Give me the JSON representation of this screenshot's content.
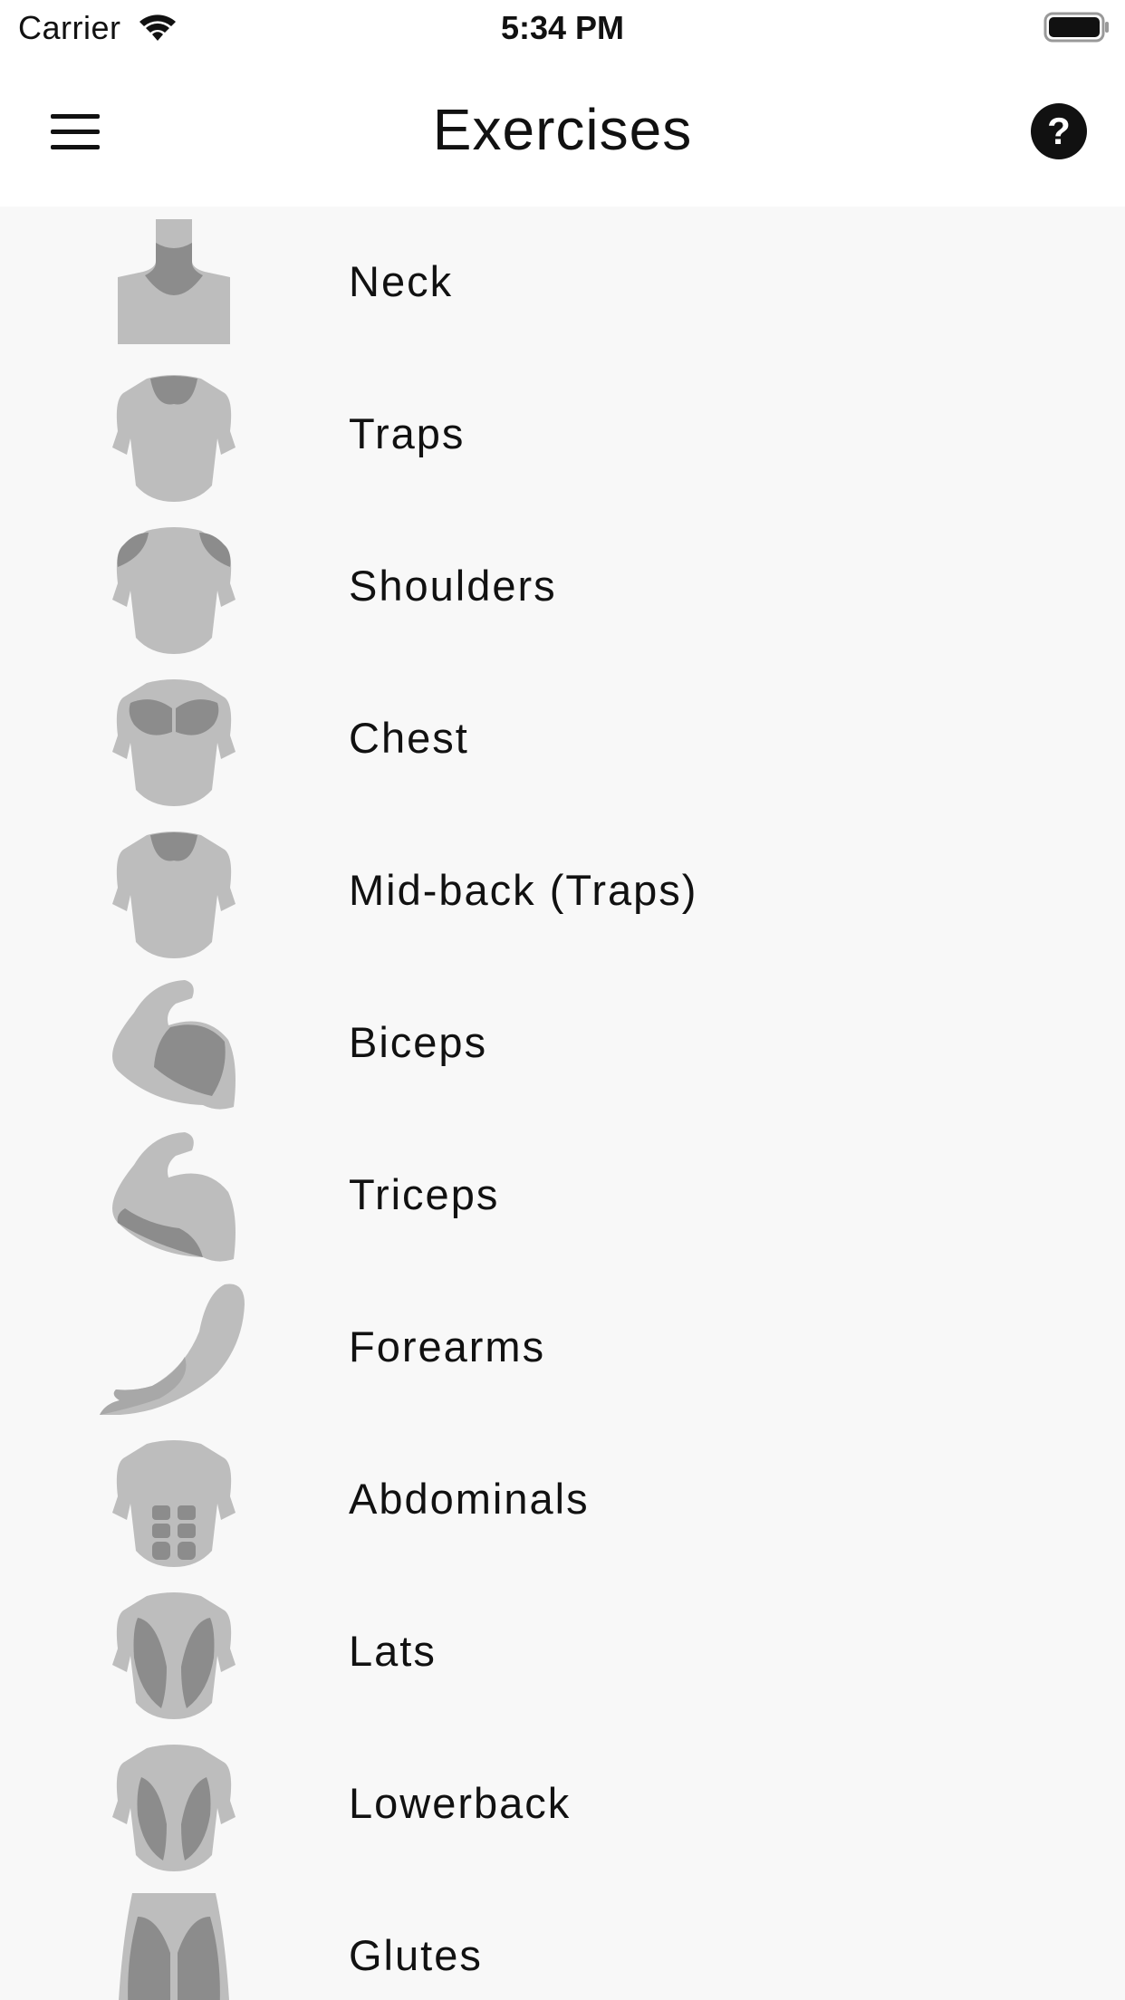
{
  "status_bar": {
    "carrier": "Carrier",
    "time": "5:34 PM",
    "wifi_icon": "wifi-icon",
    "battery_icon": "battery-full-icon"
  },
  "nav_bar": {
    "title": "Exercises",
    "menu_icon": "hamburger-menu-icon",
    "help_icon": "question-circle-icon"
  },
  "muscle_groups": [
    {
      "label": "Neck",
      "icon": "neck-icon"
    },
    {
      "label": "Traps",
      "icon": "traps-icon"
    },
    {
      "label": "Shoulders",
      "icon": "shoulders-icon"
    },
    {
      "label": "Chest",
      "icon": "chest-icon"
    },
    {
      "label": "Mid-back (Traps)",
      "icon": "mid-back-icon"
    },
    {
      "label": "Biceps",
      "icon": "biceps-icon"
    },
    {
      "label": "Triceps",
      "icon": "triceps-icon"
    },
    {
      "label": "Forearms",
      "icon": "forearms-icon"
    },
    {
      "label": "Abdominals",
      "icon": "abdominals-icon"
    },
    {
      "label": "Lats",
      "icon": "lats-icon"
    },
    {
      "label": "Lowerback",
      "icon": "lowerback-icon"
    },
    {
      "label": "Glutes",
      "icon": "glutes-icon"
    }
  ],
  "colors": {
    "body_base": "#bdbdbd",
    "muscle_highlight": "#8c8c8c",
    "list_background": "#f8f8f8",
    "header_background": "#ffffff"
  }
}
